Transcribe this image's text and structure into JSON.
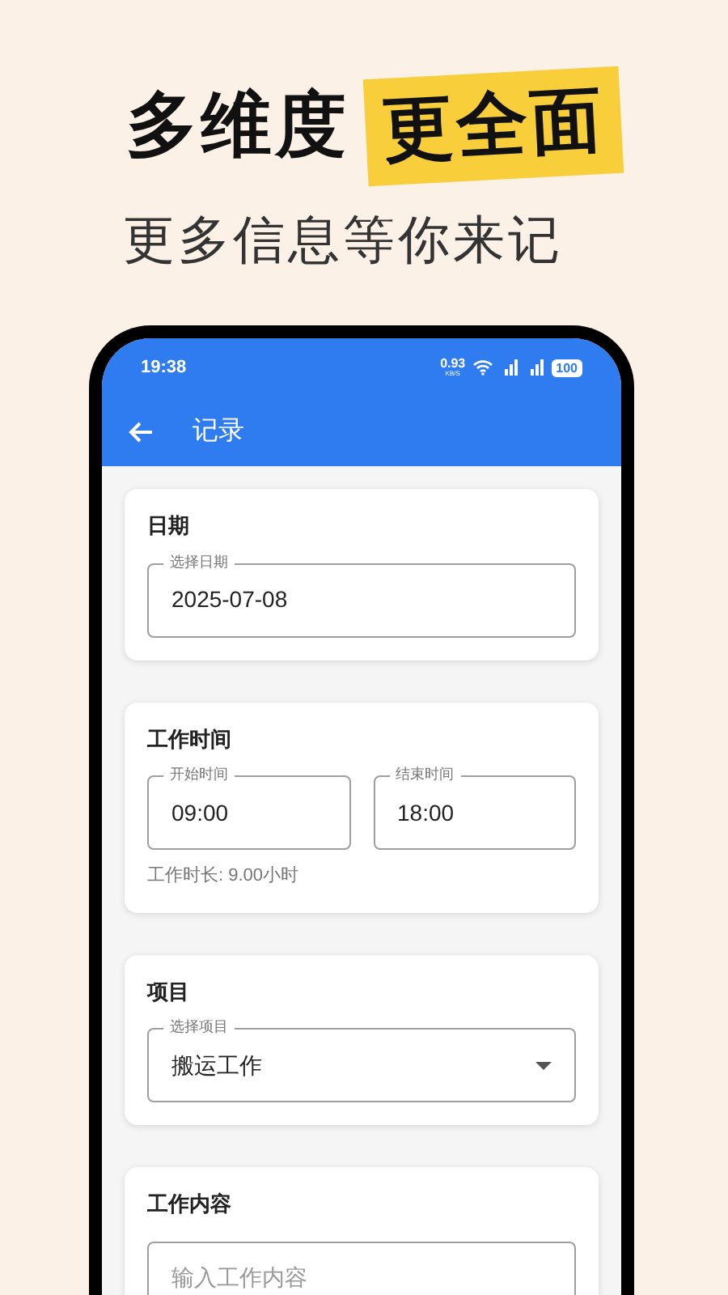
{
  "promo": {
    "headline": "多维度",
    "headline_highlight": "更全面",
    "subtitle": "更多信息等你来记"
  },
  "status_bar": {
    "time": "19:38",
    "net_speed": "0.93",
    "net_unit": "KB/S",
    "battery": "100"
  },
  "app_bar": {
    "title": "记录"
  },
  "sections": [
    {
      "title": "日期",
      "fields": [
        {
          "kind": "text",
          "label": "选择日期",
          "value": "2025-07-08"
        }
      ]
    },
    {
      "title": "工作时间",
      "fields": [
        {
          "kind": "text",
          "label": "开始时间",
          "value": "09:00"
        },
        {
          "kind": "text",
          "label": "结束时间",
          "value": "18:00"
        }
      ],
      "note": "工作时长: 9.00小时"
    },
    {
      "title": "项目",
      "fields": [
        {
          "kind": "dropdown",
          "label": "选择项目",
          "value": "搬运工作"
        }
      ]
    },
    {
      "title": "工作内容",
      "fields": [
        {
          "kind": "text",
          "placeholder": "输入工作内容"
        }
      ]
    }
  ]
}
